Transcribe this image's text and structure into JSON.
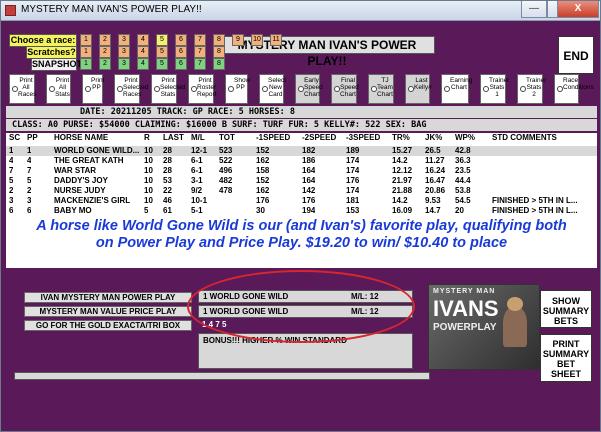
{
  "window": {
    "title": "MYSTERY MAN IVAN'S POWER PLAY!!",
    "min": "—",
    "max": "□",
    "close": "X"
  },
  "header": {
    "title": "MYSTERY MAN IVAN'S POWER PLAY!!",
    "end_label": "END"
  },
  "race_rows": {
    "choose_label": "Choose  a race:",
    "scratches_label": "Scratches?",
    "snapshot_label": "SNAPSHOT",
    "choose": [
      "1",
      "2",
      "3",
      "4",
      "5",
      "6",
      "7",
      "8",
      "9",
      "10",
      "11"
    ],
    "scratches": [
      "1",
      "2",
      "3",
      "4",
      "5",
      "6",
      "7",
      "8"
    ],
    "snapshot": [
      "1",
      "2",
      "3",
      "4",
      "5",
      "6",
      "7",
      "8"
    ]
  },
  "options": [
    {
      "label": "Print All Races"
    },
    {
      "label": "Print All Stats"
    },
    {
      "label": "Print PP"
    },
    {
      "label": "Print Selected Races"
    },
    {
      "label": "Print Selected Stats"
    },
    {
      "label": "Print Roster Report"
    },
    {
      "label": "Show PP"
    },
    {
      "label": "Select New Card"
    },
    {
      "label": "Early Speed Chart"
    },
    {
      "label": "Final Speed Chart"
    },
    {
      "label": "TJ Team Chart"
    },
    {
      "label": "Last Kelly#"
    },
    {
      "label": "Earning Chart"
    },
    {
      "label": "Trainer Stats 1"
    },
    {
      "label": "Trainer Stats 2"
    },
    {
      "label": "Race Conditions"
    }
  ],
  "info": {
    "line1": "DATE: 20211205    TRACK: GP     RACE: 5    HORSES: 8",
    "line2": "CLASS: A0  PURSE: $54000  CLAIMING: $16000 B  SURF: TURF   FUR: 5   KELLY#: 522     SEX: BAG"
  },
  "table": {
    "headers": [
      "SC",
      "PP",
      "HORSE NAME",
      "R",
      "LAST",
      "M/L",
      "TOT",
      "-1SPEED",
      "-2SPEED",
      "-3SPEED",
      "TR%",
      "JK%",
      "WP%",
      "STD COMMENTS"
    ],
    "rows": [
      [
        "1",
        "1",
        "WORLD GONE WILD...",
        "10",
        "28",
        "12-1",
        "523",
        "152",
        "182",
        "189",
        "15.27",
        "26.5",
        "42.8",
        ""
      ],
      [
        "4",
        "4",
        "THE GREAT KATH",
        "10",
        "28",
        "6-1",
        "522",
        "162",
        "186",
        "174",
        "14.2",
        "11.27",
        "36.3",
        ""
      ],
      [
        "7",
        "7",
        "WAR STAR",
        "10",
        "28",
        "6-1",
        "496",
        "158",
        "164",
        "174",
        "12.12",
        "16.24",
        "23.5",
        ""
      ],
      [
        "5",
        "5",
        "DADDY'S JOY",
        "10",
        "53",
        "3-1",
        "482",
        "152",
        "164",
        "176",
        "21.97",
        "16.47",
        "44.4",
        ""
      ],
      [
        "2",
        "2",
        "NURSE JUDY",
        "10",
        "22",
        "9/2",
        "478",
        "162",
        "142",
        "174",
        "21.88",
        "20.86",
        "53.8",
        ""
      ],
      [
        "3",
        "3",
        "MACKENZIE'S GIRL",
        "10",
        "46",
        "10-1",
        "",
        "176",
        "176",
        "181",
        "14.2",
        "9.53",
        "54.5",
        "FINISHED > 5TH IN L..."
      ],
      [
        "6",
        "6",
        "BABY MO",
        "5",
        "61",
        "5-1",
        "",
        "30",
        "194",
        "153",
        "16.09",
        "14.7",
        "20",
        "FINISHED > 5TH IN L..."
      ]
    ]
  },
  "annotation": {
    "line1": "A horse like World Gone Wild is our (and Ivan's) favorite play, qualifying both",
    "line2": "on Power Play and Price Play.  $19.20 to win/ $10.40 to place"
  },
  "bottom": {
    "power_play_label": "IVAN MYSTERY MAN POWER PLAY",
    "value_price_label": "MYSTERY MAN VALUE PRICE PLAY",
    "gold_label": "GO FOR THE GOLD EXACTA/TRI BOX",
    "power_play_result": "1  WORLD GONE WILD",
    "power_play_ml": "M/L:  12",
    "price_play_result": "1  WORLD GONE WILD",
    "price_play_ml": "M/L:  12",
    "gold_result": "1  4  7  5",
    "bonus": "BONUS!!! HIGHER % WIN STANDARD",
    "show_summary": "SHOW SUMMARY BETS",
    "print_summary": "PRINT SUMMARY BET SHEET",
    "logo_line1": "MYSTERY MAN",
    "logo_line2": "IVANS",
    "logo_line3": "POWERPLAY"
  }
}
